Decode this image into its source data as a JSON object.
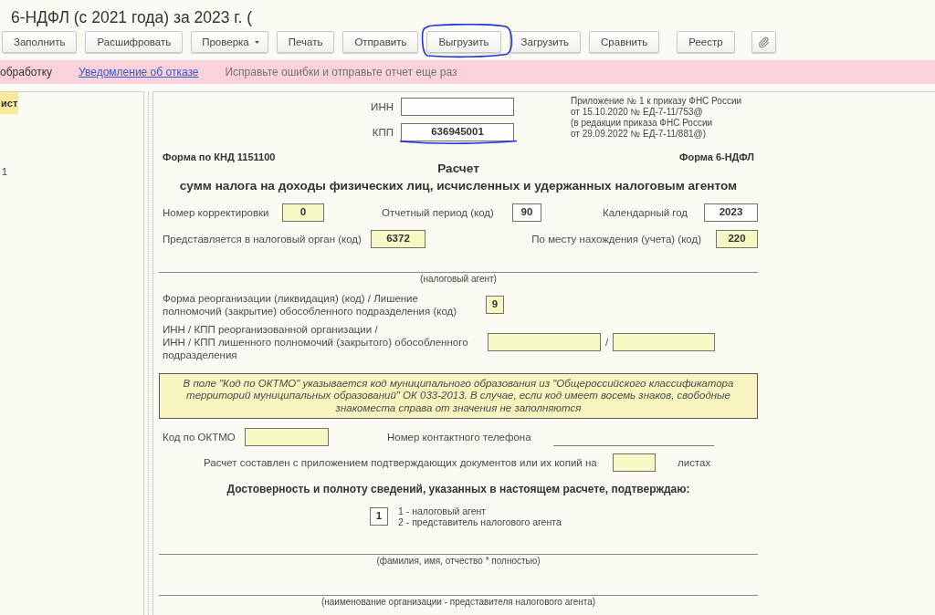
{
  "window": {
    "title": "6-НДФЛ (с 2021 года) за 2023 г. ("
  },
  "toolbar": {
    "groups": [
      [
        {
          "kind": "button",
          "label": "Заполнить"
        },
        {
          "kind": "button",
          "label": "Расшифровать"
        },
        {
          "kind": "dropdown",
          "label": "Проверка"
        },
        {
          "kind": "button",
          "label": "Печать"
        },
        {
          "kind": "button",
          "label": "Отправить"
        },
        {
          "kind": "button",
          "label": "Выгрузить"
        },
        {
          "kind": "button",
          "label": "Загрузить"
        },
        {
          "kind": "button",
          "label": "Сравнить"
        }
      ],
      [
        {
          "kind": "button",
          "label": "Реестр"
        }
      ],
      [
        {
          "kind": "attach"
        }
      ]
    ]
  },
  "notification": {
    "status": "обработку",
    "link": "Уведомление об отказе",
    "message": "Исправьте ошибки и отправьте отчет еще раз"
  },
  "sidebar": {
    "items": [
      {
        "label": "ист",
        "selected": true
      },
      {
        "label": "1",
        "selected": false
      }
    ]
  },
  "form": {
    "inn": {
      "label": "ИНН",
      "highlighted": false
    },
    "kpp": {
      "label": "КПП",
      "value": "636945001",
      "highlighted": false
    },
    "order_note": "Приложение № 1 к приказу ФНС России\nот 15.10.2020 № ЕД-7-11/753@\n(в редакции приказа ФНС России\nот 29.09.2022 № ЕД-7-11/881@)",
    "knd": "Форма по КНД 1151100",
    "form_name": "Форма 6-НДФЛ",
    "title": "Расчет",
    "subtitle": "сумм налога на доходы физических лиц, исчисленных и удержанных налоговым агентом",
    "header_fields": [
      {
        "label": "Номер корректировки",
        "value": "0",
        "highlighted": true
      },
      {
        "label": "Отчетный период (код)",
        "value": "90",
        "highlighted": false
      },
      {
        "label": "Календарный год",
        "value": "2023",
        "highlighted": false
      },
      {
        "label": "Представляется в налоговый орган (код)",
        "value": "6372",
        "highlighted": true
      },
      {
        "label": "По месту нахождения (учета) (код)",
        "value": "220",
        "highlighted": true
      }
    ],
    "agent_caption": "(налоговый агент)",
    "reorganization": {
      "label": "Форма реорганизации (ликвидация) (код) / Лишение\nполномочий (закрытие) обособленного подразделения (код)",
      "value": "9",
      "highlighted": true
    },
    "reorganized_inn_kpp": {
      "label": "ИНН / КПП реорганизованной организации /\nИНН / КПП лишенного полномочий (закрытого) обособленного\nподразделения",
      "separator": "/",
      "fields": [
        {
          "highlighted": true
        },
        {
          "highlighted": true
        }
      ]
    },
    "oktmo_note": "В поле \"Код по ОКТМО\" указывается код муниципального образования из \"Общероссийского классификатора территорий муниципальных образований\" ОК 033-2013. В случае, если код имеет восемь знаков, свободные знакоместа справа от значения не заполняются",
    "oktmo": {
      "label": "Код по ОКТМО",
      "highlighted": true
    },
    "phone": {
      "label": "Номер контактного телефона"
    },
    "attachments": {
      "label": "Расчет составлен с приложением подтверждающих документов или их копий на",
      "highlighted": true,
      "suffix": "листах"
    },
    "confirmation": "Достоверность и полноту сведений, указанных в настоящем расчете, подтверждаю:",
    "signer": {
      "value": "1",
      "highlighted": false,
      "options": [
        "1 - налоговый агент",
        "2 - представитель налогового агента"
      ]
    },
    "signature_captions": [
      "(фамилия, имя, отчество * полностью)",
      "(наименование организации - представителя налогового агента)"
    ]
  }
}
